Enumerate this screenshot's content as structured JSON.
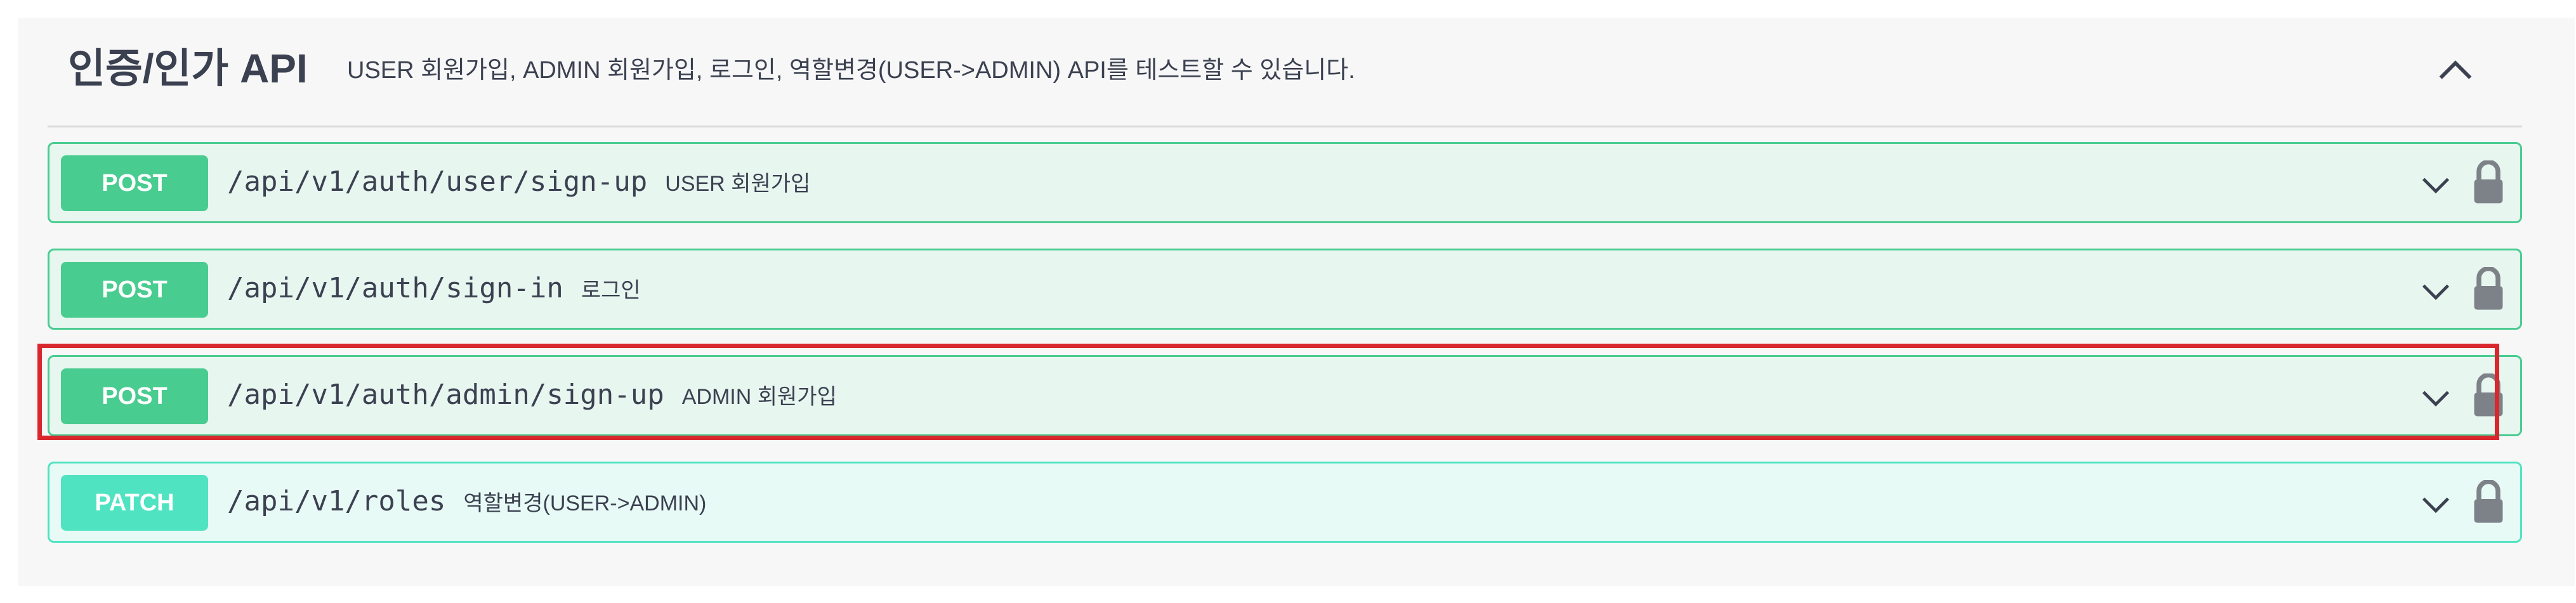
{
  "section": {
    "title": "인증/인가 API",
    "description": "USER 회원가입, ADMIN 회원가입, 로그인, 역할변경(USER->ADMIN) API를 테스트할 수 있습니다.",
    "collapse_icon": "chevron-up-icon"
  },
  "operations": [
    {
      "method": "POST",
      "path": "/api/v1/auth/user/sign-up",
      "summary": "USER 회원가입",
      "color": "#49cc90"
    },
    {
      "method": "POST",
      "path": "/api/v1/auth/sign-in",
      "summary": "로그인",
      "color": "#49cc90"
    },
    {
      "method": "POST",
      "path": "/api/v1/auth/admin/sign-up",
      "summary": "ADMIN 회원가입",
      "color": "#49cc90",
      "highlighted": true
    },
    {
      "method": "PATCH",
      "path": "/api/v1/roles",
      "summary": "역할변경(USER->ADMIN)",
      "color": "#50e3c2"
    }
  ],
  "icons": {
    "expand": "chevron-down-icon",
    "auth": "lock-icon"
  },
  "colors": {
    "post": "#49cc90",
    "patch": "#50e3c2",
    "highlight": "#d9272e",
    "text": "#3b4151"
  }
}
